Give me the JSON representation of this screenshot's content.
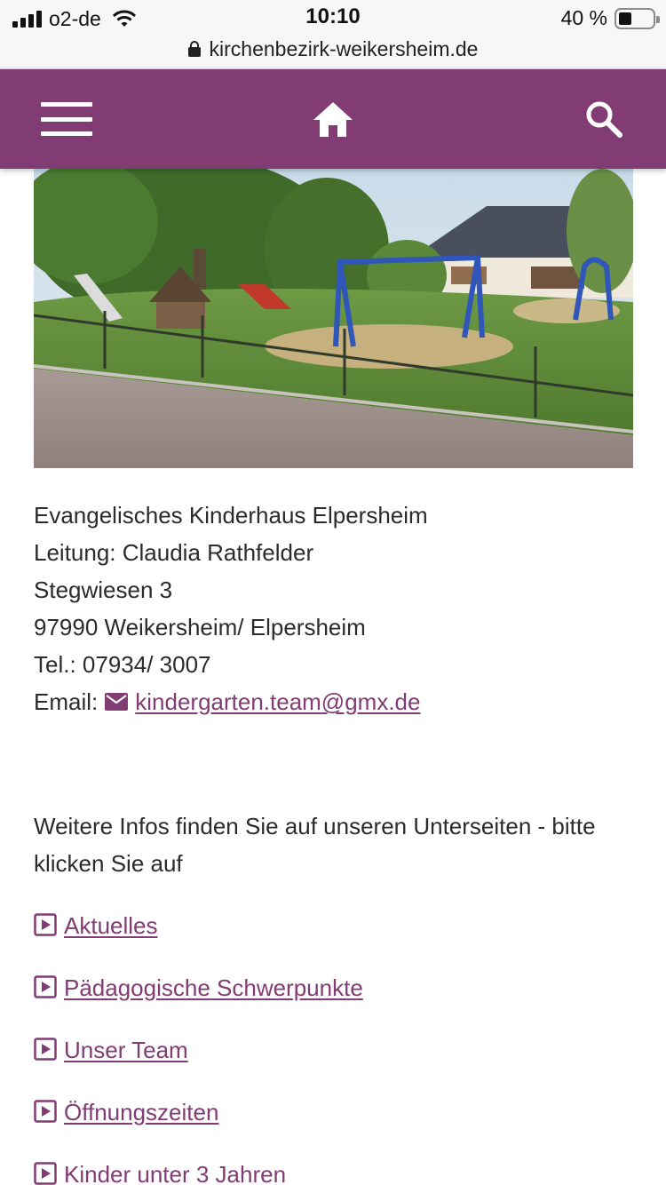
{
  "status_bar": {
    "carrier": "o2-de",
    "time": "10:10",
    "battery_percent": "40 %",
    "battery_level": 0.4,
    "url": "kirchenbezirk-weikersheim.de"
  },
  "navbar": {
    "background_color": "#813c73",
    "icons": [
      "hamburger-menu-icon",
      "home-icon",
      "search-icon"
    ]
  },
  "photo": {
    "subject": "playground-photo"
  },
  "address": {
    "name": "Evangelisches Kinderhaus Elpersheim",
    "leader": "Leitung: Claudia Rathfelder",
    "street": "Stegwiesen 3",
    "city": "97990 Weikersheim/ Elpersheim",
    "phone": "Tel.: 07934/ 3007",
    "email_label": "Email:",
    "email": "kindergarten.team@gmx.de"
  },
  "intro_text": "Weitere Infos finden Sie auf unseren Unterseiten - bitte klicken Sie auf",
  "sublinks": [
    {
      "label": "Aktuelles"
    },
    {
      "label": "Pädagogische Schwerpunkte"
    },
    {
      "label": "Unser Team"
    },
    {
      "label": "Öffnungszeiten"
    },
    {
      "label": "Kinder unter 3 Jahren"
    }
  ],
  "link_color": "#813c73"
}
